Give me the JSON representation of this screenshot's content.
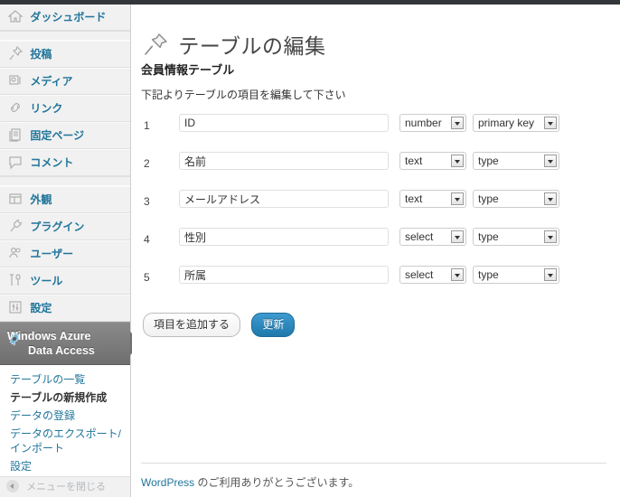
{
  "sidebar": {
    "items": [
      {
        "label": "ダッシュボード",
        "icon": "dashboard-icon"
      },
      {
        "label": "投稿",
        "icon": "post-pin-icon"
      },
      {
        "label": "メディア",
        "icon": "media-icon"
      },
      {
        "label": "リンク",
        "icon": "link-icon"
      },
      {
        "label": "固定ページ",
        "icon": "pages-icon"
      },
      {
        "label": "コメント",
        "icon": "comment-icon"
      },
      {
        "label": "外観",
        "icon": "appearance-icon"
      },
      {
        "label": "プラグイン",
        "icon": "plugin-icon"
      },
      {
        "label": "ユーザー",
        "icon": "users-icon"
      },
      {
        "label": "ツール",
        "icon": "tools-icon"
      },
      {
        "label": "設定",
        "icon": "settings-icon"
      }
    ],
    "active_item": {
      "line1": "Windows Azure",
      "line2": "Data Access",
      "icon": "gear-icon",
      "background": "#777777"
    },
    "submenu": [
      {
        "label": "テーブルの一覧",
        "current": false
      },
      {
        "label": "テーブルの新規作成",
        "current": true
      },
      {
        "label": "データの登録",
        "current": false
      },
      {
        "label": "データのエクスポート/インポート",
        "current": false
      },
      {
        "label": "設定",
        "current": false
      }
    ],
    "collapse_label": "メニューを閉じる",
    "link_color": "#21759b"
  },
  "page": {
    "title": "テーブルの編集",
    "title_icon": "pin-icon",
    "table_name": "会員情報テーブル",
    "description": "下記よりテーブルの項目を編集して下さい"
  },
  "form": {
    "rows": [
      {
        "num": "1",
        "name": "ID",
        "type": "number",
        "key": "primary key"
      },
      {
        "num": "2",
        "name": "名前",
        "type": "text",
        "key": "type"
      },
      {
        "num": "3",
        "name": "メールアドレス",
        "type": "text",
        "key": "type"
      },
      {
        "num": "4",
        "name": "性別",
        "type": "select",
        "key": "type"
      },
      {
        "num": "5",
        "name": "所属",
        "type": "select",
        "key": "type"
      }
    ],
    "add_button": "項目を追加する",
    "update_button": "更新",
    "primary_color": "#2a8bc0"
  },
  "footer": {
    "link": "WordPress",
    "text": " のご利用ありがとうございます。"
  }
}
